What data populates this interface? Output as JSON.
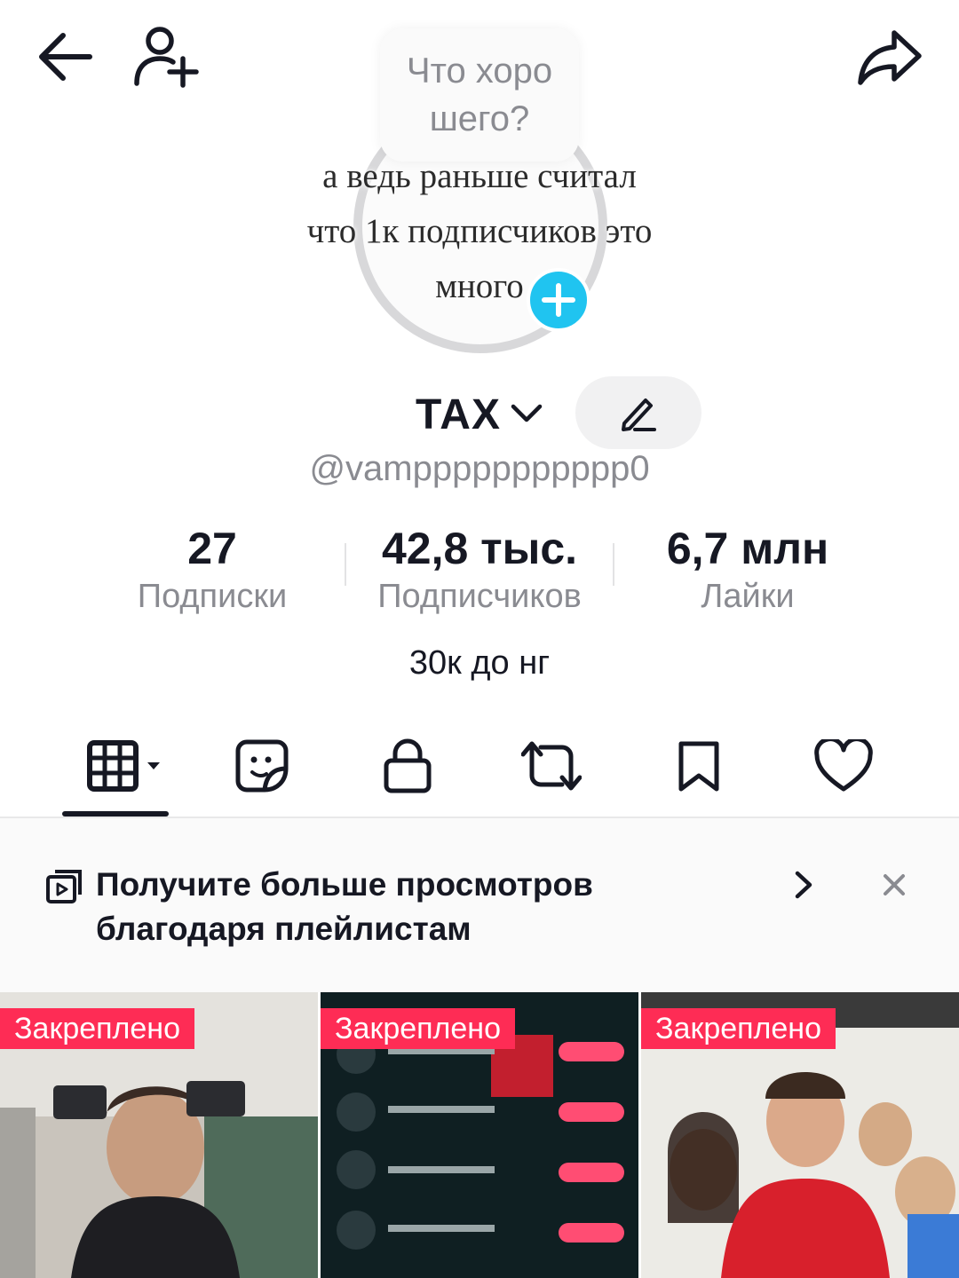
{
  "header": {
    "back_icon": "arrow-left-icon",
    "add_friend_icon": "person-plus-icon",
    "share_icon": "share-arrow-icon"
  },
  "avatar": {
    "bubble_line1": "Что хоро",
    "bubble_line2": "шего?",
    "overlay_line1": "а ведь раньше считал",
    "overlay_line2": "что 1к подписчиков это",
    "overlay_line3": "много",
    "add_icon": "plus-icon",
    "plus_color": "#20c4f0"
  },
  "profile": {
    "name": "ТАХ",
    "username": "@vamppppppppppp0",
    "bio": "30к до нг"
  },
  "stats": [
    {
      "value": "27",
      "label": "Подписки"
    },
    {
      "value": "42,8 тыс.",
      "label": "Подписчиков"
    },
    {
      "value": "6,7 млн",
      "label": "Лайки"
    }
  ],
  "tabs": [
    "videos-grid-icon",
    "sticker-icon",
    "lock-icon",
    "repost-icon",
    "bookmark-icon",
    "heart-icon"
  ],
  "banner": {
    "line1": "Получите больше просмотров",
    "line2": "благодаря плейлистам"
  },
  "videos": [
    {
      "pinned_label": "Закреплено"
    },
    {
      "pinned_label": "Закреплено"
    },
    {
      "pinned_label": "Закреплено"
    }
  ],
  "colors": {
    "accent": "#fe2c55",
    "muted": "#8a8b91",
    "text": "#161823"
  }
}
